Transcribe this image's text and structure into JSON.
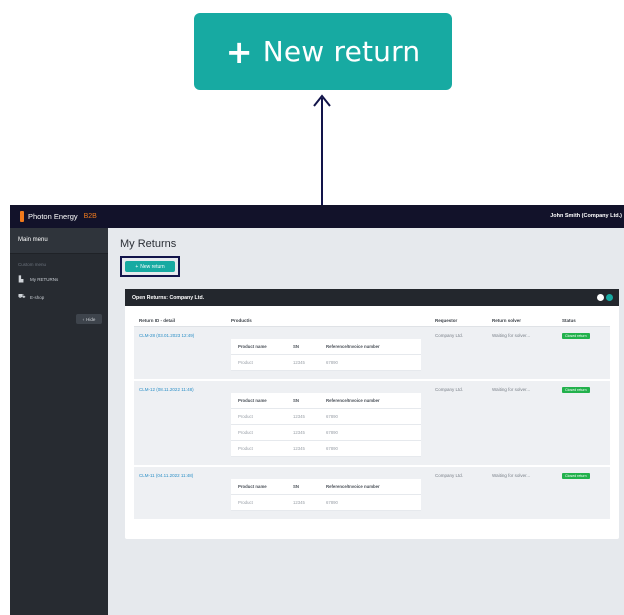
{
  "callout": {
    "plus": "+",
    "label": "New return"
  },
  "header": {
    "brand": "Photon Energy",
    "brand_tag": "B2B",
    "user": "John Smith (Company Ltd.)"
  },
  "sidebar": {
    "title": "Main menu",
    "section": "Custom menu",
    "items": [
      {
        "icon": "document-icon",
        "glyph": "▙",
        "label": "My RETURNs"
      },
      {
        "icon": "cart-icon",
        "glyph": "⛟",
        "label": "E-shop"
      }
    ],
    "hide_label": "Hide",
    "hide_glyph": "‹"
  },
  "main": {
    "title": "My Returns",
    "new_button": {
      "plus": "+",
      "label": "New return"
    },
    "panel_title": "Open Returns: Company Ltd.",
    "columns": {
      "id": "Return ID - detail",
      "products": "Product/s",
      "requestor": "Requestor",
      "solver": "Return solver",
      "status": "Status"
    },
    "inner_columns": {
      "name": "Product name",
      "sn": "SN",
      "ref": "Reference/Invoice number"
    },
    "rows": [
      {
        "id": "CLM-28 (03.01.2023 12:49)",
        "requestor": "Company Ltd.",
        "solver": "Waiting for solver...",
        "status": "Closed return",
        "products": [
          {
            "name": "Product",
            "sn": "12345",
            "ref": "67890"
          }
        ]
      },
      {
        "id": "CLM-12 (08.11.2022 11:48)",
        "requestor": "Company Ltd.",
        "solver": "Waiting for solver...",
        "status": "Closed return",
        "products": [
          {
            "name": "Product",
            "sn": "12345",
            "ref": "67890"
          },
          {
            "name": "Product",
            "sn": "12345",
            "ref": "67890"
          },
          {
            "name": "Product",
            "sn": "12345",
            "ref": "67890"
          }
        ]
      },
      {
        "id": "CLM-11 (04.11.2022 11:48)",
        "requestor": "Company Ltd.",
        "solver": "Waiting for solver...",
        "status": "Closed return",
        "products": [
          {
            "name": "Product",
            "sn": "12345",
            "ref": "67890"
          }
        ]
      }
    ]
  },
  "colors": {
    "accent": "#17aaa2",
    "topbar": "#12122a",
    "sidebar": "#272b31",
    "brand": "#f07a1c",
    "status": "#22b14c",
    "callout_line": "#12144a"
  }
}
